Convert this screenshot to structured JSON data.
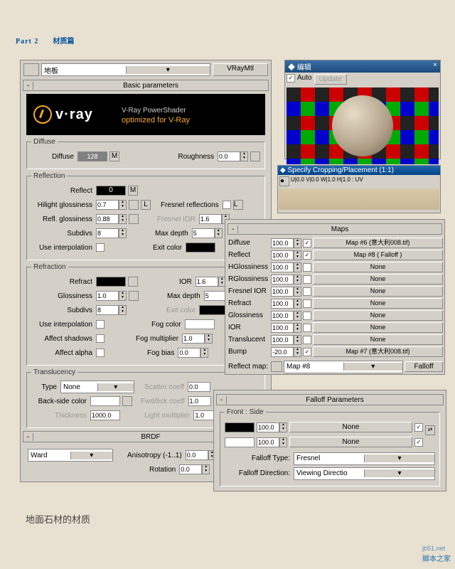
{
  "title": {
    "part": "Part 2",
    "cn": "材质篇"
  },
  "top": {
    "material_name": "地板",
    "type_btn": "VRayMtl"
  },
  "headers": {
    "basic": "Basic parameters",
    "brdf": "BRDF",
    "maps": "Maps",
    "falloff": "Falloff Parameters"
  },
  "banner": {
    "brand": "v·ray",
    "line1": "V-Ray PowerShader",
    "line2": "optimized for V-Ray"
  },
  "diffuse": {
    "legend": "Diffuse",
    "diffuse_lbl": "Diffuse",
    "swatch_val": "128",
    "m": "M",
    "rough_lbl": "Roughness",
    "rough": "0.0"
  },
  "reflection": {
    "legend": "Reflection",
    "reflect_lbl": "Reflect",
    "reflect_val": "0",
    "m": "M",
    "hilight_lbl": "Hilight glossiness",
    "hilight": "0.7",
    "l": "L",
    "fresnel_lbl": "Fresnel reflections",
    "reflgloss_lbl": "Refl. glossiness",
    "reflgloss": "0.88",
    "fresnelior_lbl": "Fresnel IOR",
    "fresnelior": "1.6",
    "subdivs_lbl": "Subdivs",
    "subdivs": "8",
    "maxdepth_lbl": "Max depth",
    "maxdepth": "5",
    "useinterp_lbl": "Use interpolation",
    "exitcolor_lbl": "Exit color"
  },
  "refraction": {
    "legend": "Refraction",
    "refract_lbl": "Refract",
    "ior_lbl": "IOR",
    "ior": "1.6",
    "gloss_lbl": "Glossiness",
    "gloss": "1.0",
    "maxdepth_lbl": "Max depth",
    "maxdepth": "5",
    "subdivs_lbl": "Subdivs",
    "subdivs": "8",
    "exitcolor_lbl": "Exit color",
    "useinterp_lbl": "Use interpolation",
    "fogcolor_lbl": "Fog color",
    "shadows_lbl": "Affect shadows",
    "fogmult_lbl": "Fog multiplier",
    "fogmult": "1.0",
    "alpha_lbl": "Affect alpha",
    "fogbias_lbl": "Fog bias",
    "fogbias": "0.0"
  },
  "translucency": {
    "legend": "Translucency",
    "type_lbl": "Type",
    "type_val": "None",
    "scatter_lbl": "Scatter coeff",
    "scatter": "0.0",
    "backside_lbl": "Back-side color",
    "fwdbck_lbl": "Fwd/bck coeff",
    "fwdbck": "1.0",
    "thick_lbl": "Thickness",
    "thick": "1000.0",
    "lightmult_lbl": "Light multiplier",
    "lightmult": "1.0"
  },
  "brdf": {
    "type": "Ward",
    "aniso_lbl": "Anisotropy (-1..1)",
    "aniso": "0.0",
    "rot_lbl": "Rotation",
    "rot": "0.0"
  },
  "preview": {
    "title": "编辑",
    "auto": "Auto",
    "update": "Update",
    "x": "×"
  },
  "crop": {
    "title": "Specify Cropping/Placement (1:1)",
    "uv": "U|0.0  V|0.0  W|1.0  H|1.0 : UV"
  },
  "maps": {
    "reflect_map_lbl": "Reflect map:",
    "reflect_map_val": "Map #8",
    "falloff_btn": "Falloff",
    "rows": [
      {
        "name": "Diffuse",
        "val": "100.0",
        "on": true,
        "map": "Map #6 (意大利008.tif)"
      },
      {
        "name": "Reflect",
        "val": "100.0",
        "on": true,
        "map": "Map #8  ( Falloff )"
      },
      {
        "name": "HGlossiness",
        "val": "100.0",
        "on": false,
        "map": "None"
      },
      {
        "name": "RGlossiness",
        "val": "100.0",
        "on": false,
        "map": "None"
      },
      {
        "name": "Fresnel IOR",
        "val": "100.0",
        "on": false,
        "map": "None"
      },
      {
        "name": "Refract",
        "val": "100.0",
        "on": false,
        "map": "None"
      },
      {
        "name": "Glossiness",
        "val": "100.0",
        "on": false,
        "map": "None"
      },
      {
        "name": "IOR",
        "val": "100.0",
        "on": false,
        "map": "None"
      },
      {
        "name": "Translucent",
        "val": "100.0",
        "on": false,
        "map": "None"
      },
      {
        "name": "Bump",
        "val": "-20.0",
        "on": true,
        "map": "Map #7 (意大利008.tif)"
      }
    ]
  },
  "falloff": {
    "frontside": "Front : Side",
    "rows": [
      {
        "val": "100.0",
        "map": "None",
        "color": "#000"
      },
      {
        "val": "100.0",
        "map": "None",
        "color": "#fff"
      }
    ],
    "type_lbl": "Falloff Type:",
    "type": "Fresnel",
    "dir_lbl": "Falloff Direction:",
    "dir": "Viewing Directio"
  },
  "footer": "地面石材的材质",
  "watermark": {
    "top": "jb51.net",
    "bot": "脚本之家"
  }
}
